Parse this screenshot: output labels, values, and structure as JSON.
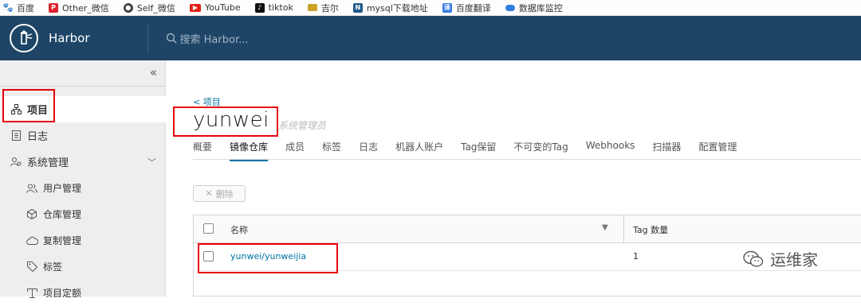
{
  "bookmarks": [
    {
      "label": "百度",
      "icon": "paw-icon",
      "color": "#2e5cd6"
    },
    {
      "label": "Other_微信",
      "icon": "p-logo-icon",
      "color": "#d9242c"
    },
    {
      "label": "Self_微信",
      "icon": "globe-icon",
      "color": "#444444"
    },
    {
      "label": "YouTube",
      "icon": "youtube-icon",
      "color": "#e62117"
    },
    {
      "label": "tiktok",
      "icon": "tiktok-icon",
      "color": "#111111"
    },
    {
      "label": "吉尔",
      "icon": "folder-icon",
      "color": "#999999"
    },
    {
      "label": "mysql下载地址",
      "icon": "mysql-icon",
      "color": "#245a8a"
    },
    {
      "label": "百度翻译",
      "icon": "translate-icon",
      "color": "#3a7be0"
    },
    {
      "label": "数据库监控",
      "icon": "cloud-icon",
      "color": "#2f7de1"
    }
  ],
  "header": {
    "brand": "Harbor",
    "search_placeholder": "搜索 Harbor...",
    "bg_color": "#1e4566"
  },
  "sidebar": {
    "collapse_icon": "double-chevron-left-icon",
    "projects": "项目",
    "logs": "日志",
    "admin": "系统管理",
    "sub_items": [
      {
        "label": "用户管理",
        "icon": "users-icon"
      },
      {
        "label": "仓库管理",
        "icon": "cube-icon"
      },
      {
        "label": "复制管理",
        "icon": "cloud-sync-icon"
      },
      {
        "label": "标签",
        "icon": "tag-icon"
      },
      {
        "label": "项目定额",
        "icon": "quota-icon"
      }
    ]
  },
  "main": {
    "back_link": "< 项目",
    "project_title": "yunwei",
    "role": "系统管理员",
    "tabs": [
      "概要",
      "镜像仓库",
      "成员",
      "标签",
      "日志",
      "机器人账户",
      "Tag保留",
      "不可变的Tag",
      "Webhooks",
      "扫描器",
      "配置管理"
    ],
    "active_tab": 1,
    "delete_button": "删除",
    "table": {
      "col_name": "名称",
      "col_tags": "Tag 数量",
      "rows": [
        {
          "name": "yunwei/yunweijia",
          "tags": "1"
        }
      ]
    },
    "accent_color": "#0072a3"
  },
  "watermark": {
    "text": "运维家"
  }
}
